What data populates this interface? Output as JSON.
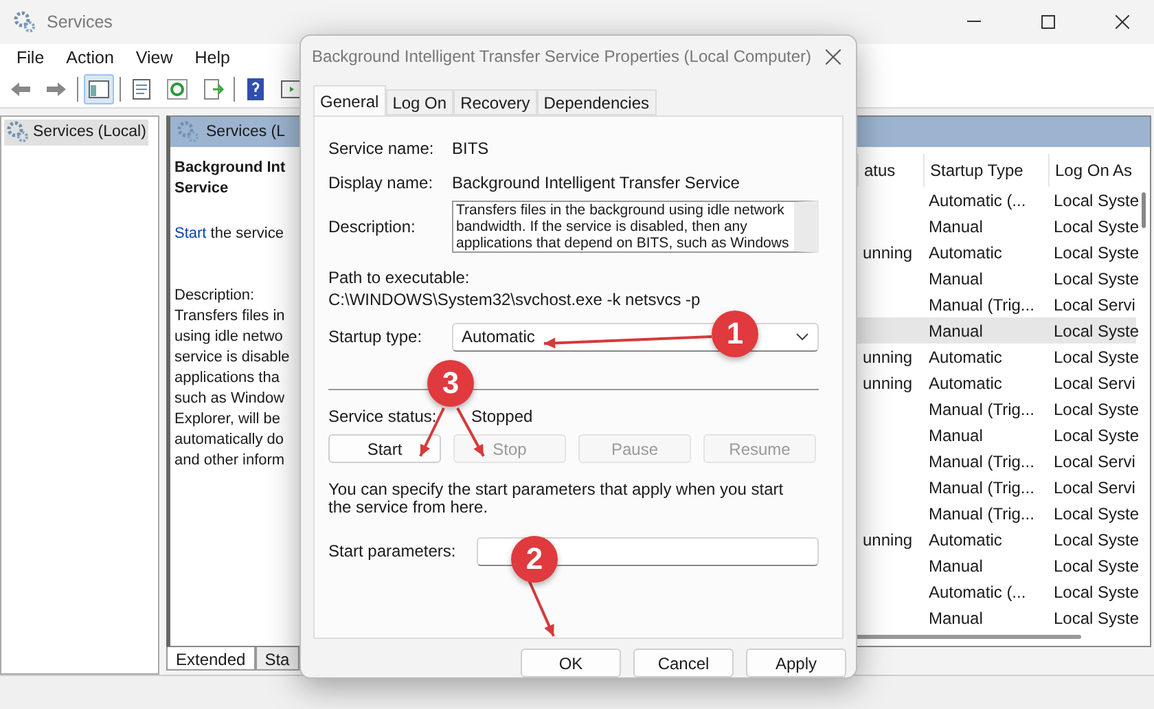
{
  "window": {
    "title": "Services"
  },
  "menu": [
    "File",
    "Action",
    "View",
    "Help"
  ],
  "tree": [
    {
      "label": "Services (Local)",
      "selected": true
    }
  ],
  "pane_header": "Services (L",
  "extended": {
    "title_lines": [
      "Background Int",
      "Service"
    ],
    "link": "Start",
    "link_suffix": "the service",
    "description_label": "Description:",
    "description_lines": [
      "Transfers files in",
      "using idle netwo",
      "service is disable",
      "applications tha",
      "such as Window",
      "Explorer, will be",
      "automatically do",
      "and other inform"
    ]
  },
  "list": {
    "columns": [
      "atus",
      "Startup Type",
      "Log On As"
    ],
    "rows": [
      {
        "startup": "Automatic (...",
        "log_on": "Local Syste",
        "selected": false
      },
      {
        "startup": "Manual",
        "log_on": "Local Syste",
        "selected": false
      },
      {
        "status": "unning",
        "startup": "Automatic",
        "log_on": "Local Syste",
        "selected": false
      },
      {
        "startup": "Manual",
        "log_on": "Local Syste",
        "selected": false
      },
      {
        "startup": "Manual (Trig...",
        "log_on": "Local Servi",
        "selected": false
      },
      {
        "startup": "Manual",
        "log_on": "Local Syste",
        "selected": true
      },
      {
        "status": "unning",
        "startup": "Automatic",
        "log_on": "Local Syste",
        "selected": false
      },
      {
        "status": "unning",
        "startup": "Automatic",
        "log_on": "Local Servi",
        "selected": false
      },
      {
        "startup": "Manual (Trig...",
        "log_on": "Local Syste",
        "selected": false
      },
      {
        "startup": "Manual",
        "log_on": "Local Syste",
        "selected": false
      },
      {
        "startup": "Manual (Trig...",
        "log_on": "Local Servi",
        "selected": false
      },
      {
        "startup": "Manual (Trig...",
        "log_on": "Local Servi",
        "selected": false
      },
      {
        "startup": "Manual (Trig...",
        "log_on": "Local Syste",
        "selected": false
      },
      {
        "status": "unning",
        "startup": "Automatic",
        "log_on": "Local Syste",
        "selected": false
      },
      {
        "startup": "Manual",
        "log_on": "Local Syste",
        "selected": false
      },
      {
        "startup": "Automatic (...",
        "log_on": "Local Syste",
        "selected": false
      },
      {
        "startup": "Manual",
        "log_on": "Local Syste",
        "selected": false
      }
    ]
  },
  "view_tabs": [
    {
      "label": "Extended",
      "selected": true
    },
    {
      "label": "Sta",
      "selected": false
    }
  ],
  "dialog": {
    "title": "Background Intelligent Transfer Service Properties (Local Computer)",
    "tabs": [
      {
        "label": "General",
        "selected": true
      },
      {
        "label": "Log On",
        "selected": false
      },
      {
        "label": "Recovery",
        "selected": false
      },
      {
        "label": "Dependencies",
        "selected": false
      }
    ],
    "service_name_label": "Service name:",
    "service_name": "BITS",
    "display_name_label": "Display name:",
    "display_name": "Background Intelligent Transfer Service",
    "description_label": "Description:",
    "description": "Transfers files in the background using idle network bandwidth. If the service is disabled, then any applications that depend on BITS, such as Windows",
    "path_label": "Path to executable:",
    "path": "C:\\WINDOWS\\System32\\svchost.exe -k netsvcs -p",
    "startup_type_label": "Startup type:",
    "startup_type": "Automatic",
    "status_label": "Service status:",
    "status": "Stopped",
    "service_buttons": [
      {
        "label": "Start",
        "disabled": false
      },
      {
        "label": "Stop",
        "disabled": true
      },
      {
        "label": "Pause",
        "disabled": true
      },
      {
        "label": "Resume",
        "disabled": true
      }
    ],
    "note": "You can specify the start parameters that apply when you start the service from here.",
    "params_label": "Start parameters:",
    "buttons": [
      "OK",
      "Cancel",
      "Apply"
    ]
  },
  "annotations": [
    {
      "number": "1"
    },
    {
      "number": "2"
    },
    {
      "number": "3"
    }
  ]
}
